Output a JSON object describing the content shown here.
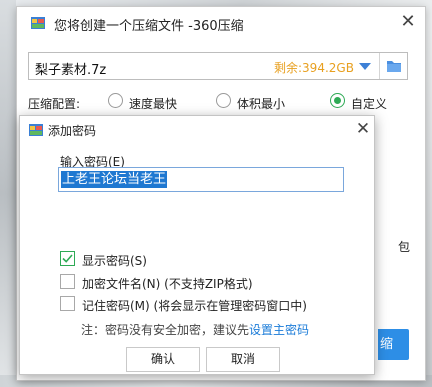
{
  "main_window": {
    "title": "您将创建一个压缩文件 -360压缩",
    "close_glyph": "✕",
    "file_name": "梨子素材.7z",
    "free_space": "剩余:394.2GB",
    "config_label": "压缩配置:",
    "options": [
      {
        "label": "速度最快",
        "checked": false
      },
      {
        "label": "体积最小",
        "checked": false
      },
      {
        "label": "自定义",
        "checked": true
      }
    ],
    "side_text": "包",
    "compress_button_fragment": "缩"
  },
  "dialog": {
    "title": "添加密码",
    "close_glyph": "✕",
    "password_label": "输入密码(E)",
    "password_value": "上老王论坛当老王",
    "checkboxes": [
      {
        "label": "显示密码(S)",
        "checked": true
      },
      {
        "label": "加密文件名(N) (不支持ZIP格式)",
        "checked": false
      },
      {
        "label": "记住密码(M) (将会显示在管理密码窗口中)",
        "checked": false
      }
    ],
    "note_text": "注：密码没有安全加密，建议先",
    "note_link": "设置主密码",
    "ok_label": "确认",
    "cancel_label": "取消"
  },
  "colors": {
    "accent": "#2d8ee6",
    "free_space": "#e8a020",
    "check_green": "#2eaa55",
    "link": "#1a7bd8"
  },
  "icons": [
    "app-icon",
    "close-icon",
    "dropdown-arrow-icon",
    "folder-icon",
    "lock-icon",
    "checkmark-icon"
  ]
}
